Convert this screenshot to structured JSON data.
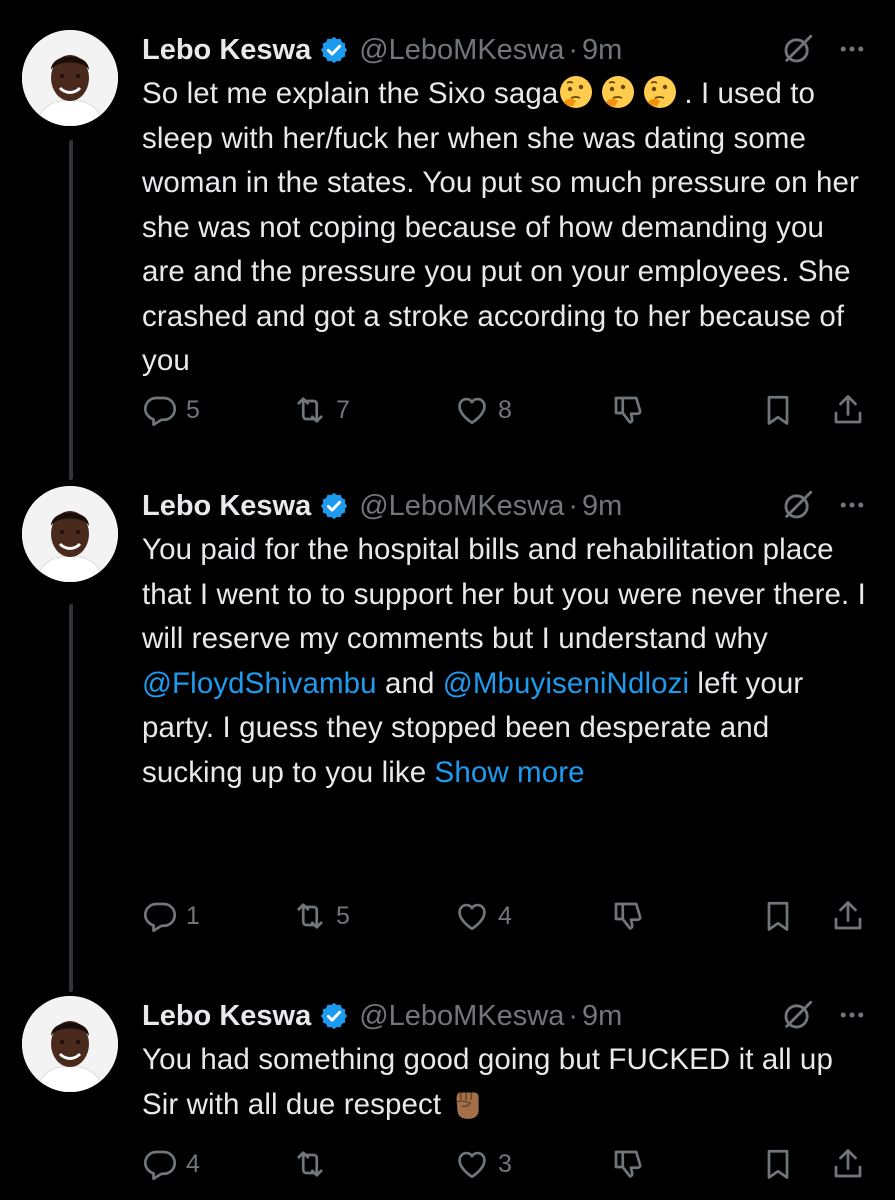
{
  "colors": {
    "background": "#000000",
    "text": "#e7e9ea",
    "muted": "#71767b",
    "link": "#1d9bf0",
    "verified": "#1d9bf0",
    "thread_line": "#333639"
  },
  "icons": {
    "verified": "verified-badge-icon",
    "grok": "grok-icon",
    "more": "more-options-icon",
    "reply": "reply-icon",
    "repost": "repost-icon",
    "like": "like-icon",
    "dislike": "dislike-icon",
    "bookmark": "bookmark-icon",
    "share": "share-icon"
  },
  "tweets": [
    {
      "author": "Lebo Keswa",
      "handle": "@LeboMKeswa",
      "separator": "·",
      "time": "9m",
      "text_1": "So let me explain the Sixo saga",
      "emoji_1": "🤔🤔🤔",
      "text_2": ". I used to sleep with her/fuck her when she was dating some woman in the states. You put so much pressure on her she was not coping because of how demanding you are and the pressure you put on your employees. She crashed and got a stroke according to her because of you",
      "replies": "5",
      "reposts": "7",
      "likes": "8"
    },
    {
      "author": "Lebo Keswa",
      "handle": "@LeboMKeswa",
      "separator": "·",
      "time": "9m",
      "text_1": "You paid for the hospital bills and rehabilitation place that I went to to support her but you were never there. I will reserve my comments but I understand why ",
      "mention_1": "@FloydShivambu",
      "text_2": " and ",
      "mention_2": "@MbuyiseniNdlozi",
      "text_3": " left your party. I guess they stopped been desperate and sucking up to you like ",
      "show_more": "Show more",
      "replies": "1",
      "reposts": "5",
      "likes": "4"
    },
    {
      "author": "Lebo Keswa",
      "handle": "@LeboMKeswa",
      "separator": "·",
      "time": "9m",
      "text_1": "You had something good going but FUCKED it all up Sir with all due respect",
      "emoji_1": "✊🏾",
      "replies": "4",
      "reposts": "",
      "likes": "3"
    }
  ]
}
